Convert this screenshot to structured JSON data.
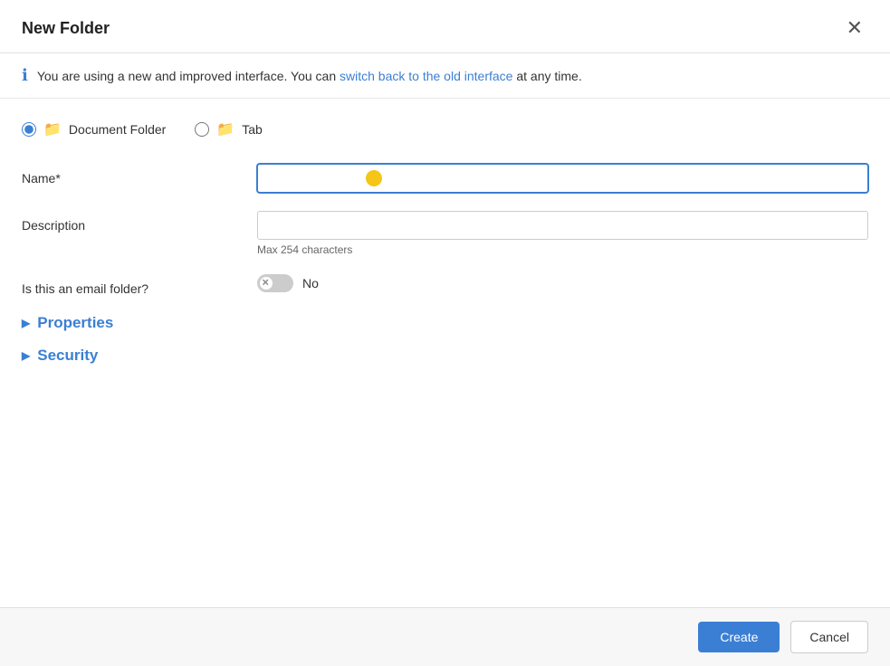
{
  "dialog": {
    "title": "New Folder",
    "close_label": "✕"
  },
  "info_banner": {
    "text_before": "You are using a new and improved interface. You can ",
    "link_text": "switch back to the old interface",
    "text_after": " at any time."
  },
  "folder_types": [
    {
      "id": "document",
      "label": "Document Folder",
      "selected": true
    },
    {
      "id": "tab",
      "label": "Tab",
      "selected": false
    }
  ],
  "form": {
    "name_label": "Name*",
    "name_placeholder": "",
    "description_label": "Description",
    "description_placeholder": "",
    "max_chars_text": "Max 254 characters",
    "email_folder_label": "Is this an email folder?",
    "toggle_no_label": "No"
  },
  "sections": {
    "properties_label": "Properties",
    "security_label": "Security"
  },
  "footer": {
    "create_label": "Create",
    "cancel_label": "Cancel"
  }
}
